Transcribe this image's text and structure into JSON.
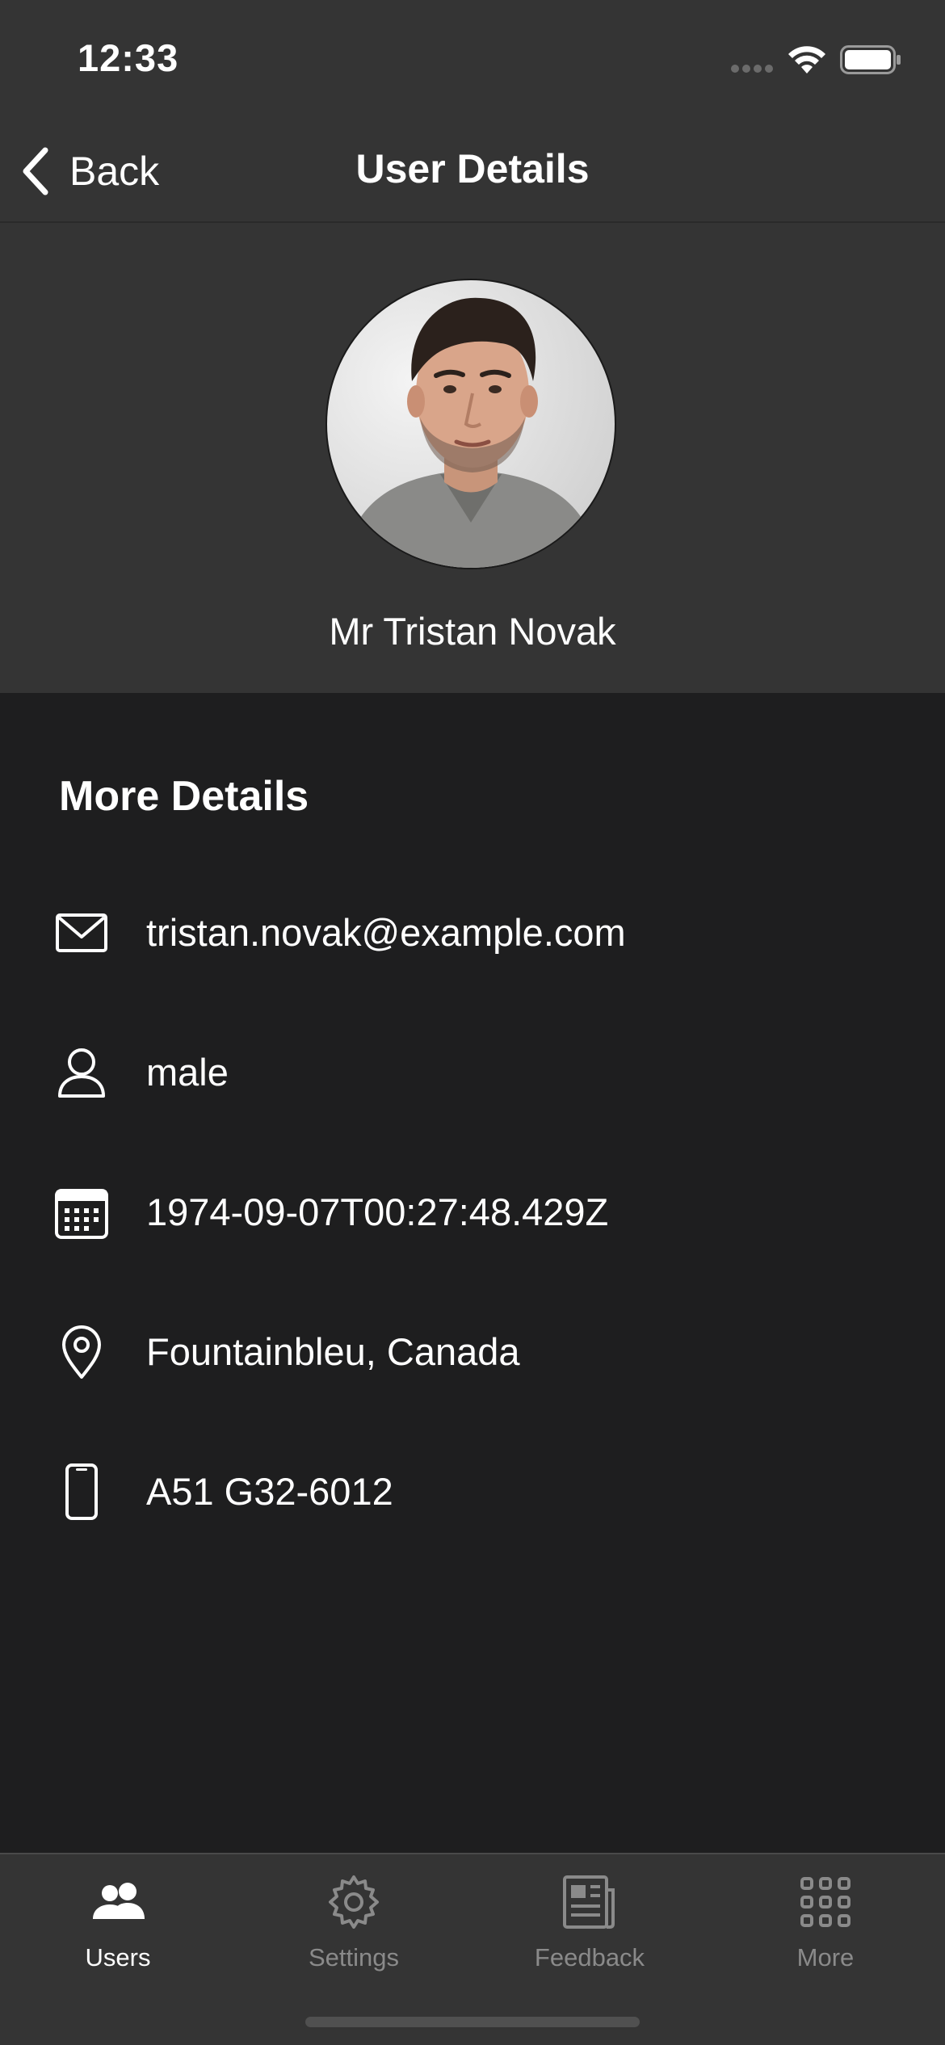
{
  "status_bar": {
    "time": "12:33"
  },
  "nav": {
    "back_label": "Back",
    "title": "User Details"
  },
  "profile": {
    "name": "Mr Tristan Novak"
  },
  "details": {
    "heading": "More Details",
    "rows": [
      {
        "icon": "envelope-icon",
        "value": "tristan.novak@example.com"
      },
      {
        "icon": "person-icon",
        "value": "male"
      },
      {
        "icon": "calendar-icon",
        "value": "1974-09-07T00:27:48.429Z"
      },
      {
        "icon": "location-pin-icon",
        "value": "Fountainbleu, Canada"
      },
      {
        "icon": "phone-icon",
        "value": "A51 G32-6012"
      }
    ]
  },
  "tabs": [
    {
      "label": "Users",
      "icon": "users-icon",
      "active": true
    },
    {
      "label": "Settings",
      "icon": "gear-icon",
      "active": false
    },
    {
      "label": "Feedback",
      "icon": "newspaper-icon",
      "active": false
    },
    {
      "label": "More",
      "icon": "grid-icon",
      "active": false
    }
  ],
  "colors": {
    "bar_background": "#343434",
    "content_background": "#1e1e1f",
    "active_tab": "#ffffff",
    "inactive_tab": "#8a8a8a"
  }
}
